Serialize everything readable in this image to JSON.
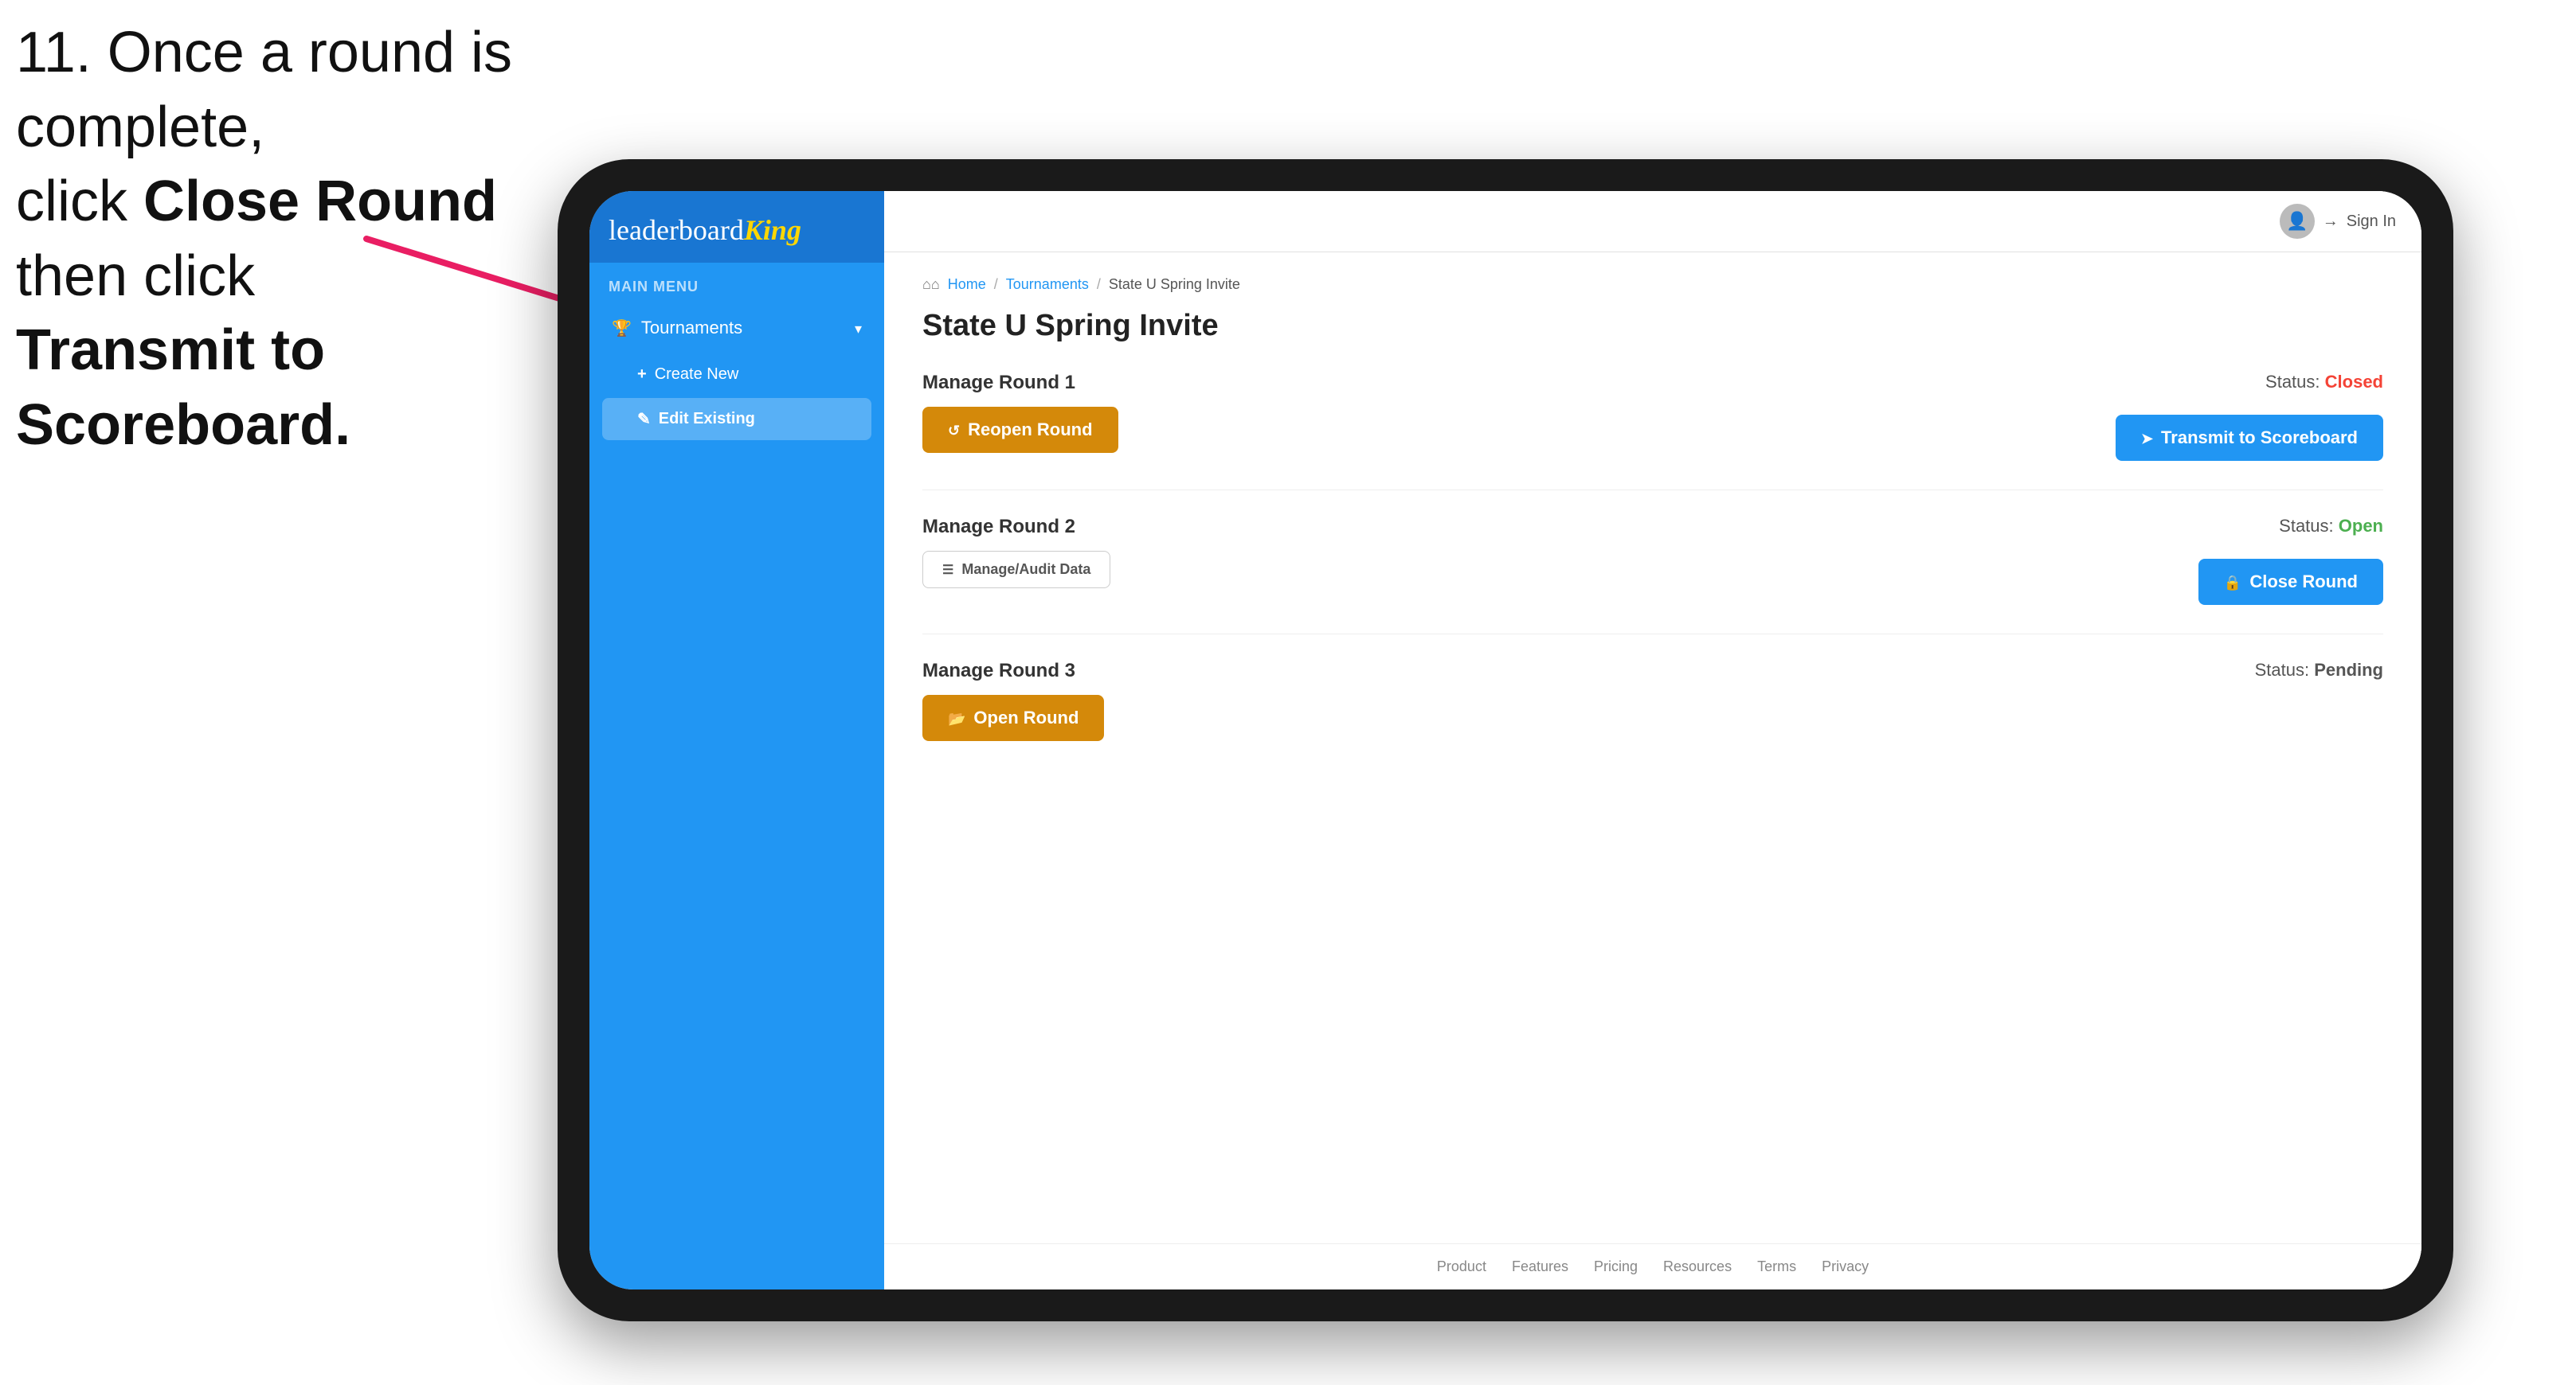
{
  "instruction": {
    "line1": "11. Once a round is complete,",
    "line2_prefix": "click ",
    "line2_bold": "Close Round",
    "line2_suffix": " then click",
    "line3_bold": "Transmit to Scoreboard."
  },
  "header": {
    "sign_in_label": "Sign In"
  },
  "breadcrumb": {
    "home": "Home",
    "sep1": "/",
    "tournaments": "Tournaments",
    "sep2": "/",
    "current": "State U Spring Invite"
  },
  "page": {
    "title": "State U Spring Invite"
  },
  "sidebar": {
    "logo": "leaderboard",
    "logo_brand": "King",
    "main_menu_label": "MAIN MENU",
    "tournaments_label": "Tournaments",
    "create_new_label": "Create New",
    "edit_existing_label": "Edit Existing"
  },
  "rounds": [
    {
      "label": "Manage Round 1",
      "status_label": "Status:",
      "status_value": "Closed",
      "status_class": "closed",
      "button1_label": "Reopen Round",
      "button2_label": "Transmit to Scoreboard",
      "button1_type": "amber",
      "button2_type": "blue",
      "show_manage": false
    },
    {
      "label": "Manage Round 2",
      "status_label": "Status:",
      "status_value": "Open",
      "status_class": "open",
      "button1_label": "Manage/Audit Data",
      "button2_label": "Close Round",
      "button1_type": "manage",
      "button2_type": "blue",
      "show_manage": true
    },
    {
      "label": "Manage Round 3",
      "status_label": "Status:",
      "status_value": "Pending",
      "status_class": "pending",
      "button1_label": "Open Round",
      "button1_type": "amber",
      "show_manage": false,
      "no_right_button": true
    }
  ],
  "footer": {
    "links": [
      "Product",
      "Features",
      "Pricing",
      "Resources",
      "Terms",
      "Privacy"
    ]
  }
}
